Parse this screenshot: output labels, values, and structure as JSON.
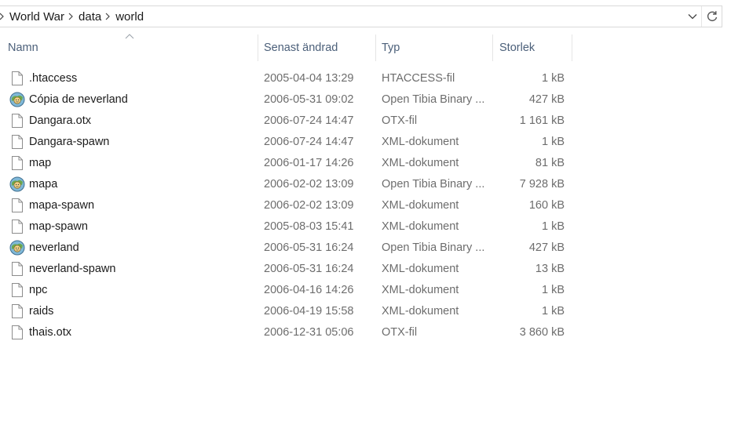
{
  "breadcrumb": {
    "items": [
      "World War",
      "data",
      "world"
    ]
  },
  "columns": {
    "name": "Namn",
    "date": "Senast ändrad",
    "type": "Typ",
    "size": "Storlek"
  },
  "files": [
    {
      "icon": "file-icon",
      "name": ".htaccess",
      "date": "2005-04-04 13:29",
      "type": "HTACCESS-fil",
      "size": "1 kB"
    },
    {
      "icon": "otbm-icon",
      "name": "Cópia de neverland",
      "date": "2006-05-31 09:02",
      "type": "Open Tibia Binary ...",
      "size": "427 kB"
    },
    {
      "icon": "file-icon",
      "name": "Dangara.otx",
      "date": "2006-07-24 14:47",
      "type": "OTX-fil",
      "size": "1 161 kB"
    },
    {
      "icon": "file-icon",
      "name": "Dangara-spawn",
      "date": "2006-07-24 14:47",
      "type": "XML-dokument",
      "size": "1 kB"
    },
    {
      "icon": "file-icon",
      "name": "map",
      "date": "2006-01-17 14:26",
      "type": "XML-dokument",
      "size": "81 kB"
    },
    {
      "icon": "otbm-icon",
      "name": "mapa",
      "date": "2006-02-02 13:09",
      "type": "Open Tibia Binary ...",
      "size": "7 928 kB"
    },
    {
      "icon": "file-icon",
      "name": "mapa-spawn",
      "date": "2006-02-02 13:09",
      "type": "XML-dokument",
      "size": "160 kB"
    },
    {
      "icon": "file-icon",
      "name": "map-spawn",
      "date": "2005-08-03 15:41",
      "type": "XML-dokument",
      "size": "1 kB"
    },
    {
      "icon": "otbm-icon",
      "name": "neverland",
      "date": "2006-05-31 16:24",
      "type": "Open Tibia Binary ...",
      "size": "427 kB"
    },
    {
      "icon": "file-icon",
      "name": "neverland-spawn",
      "date": "2006-05-31 16:24",
      "type": "XML-dokument",
      "size": "13 kB"
    },
    {
      "icon": "file-icon",
      "name": "npc",
      "date": "2006-04-16 14:26",
      "type": "XML-dokument",
      "size": "1 kB"
    },
    {
      "icon": "file-icon",
      "name": "raids",
      "date": "2006-04-19 15:58",
      "type": "XML-dokument",
      "size": "1 kB"
    },
    {
      "icon": "file-icon",
      "name": "thais.otx",
      "date": "2006-12-31 05:06",
      "type": "OTX-fil",
      "size": "3 860 kB"
    }
  ]
}
